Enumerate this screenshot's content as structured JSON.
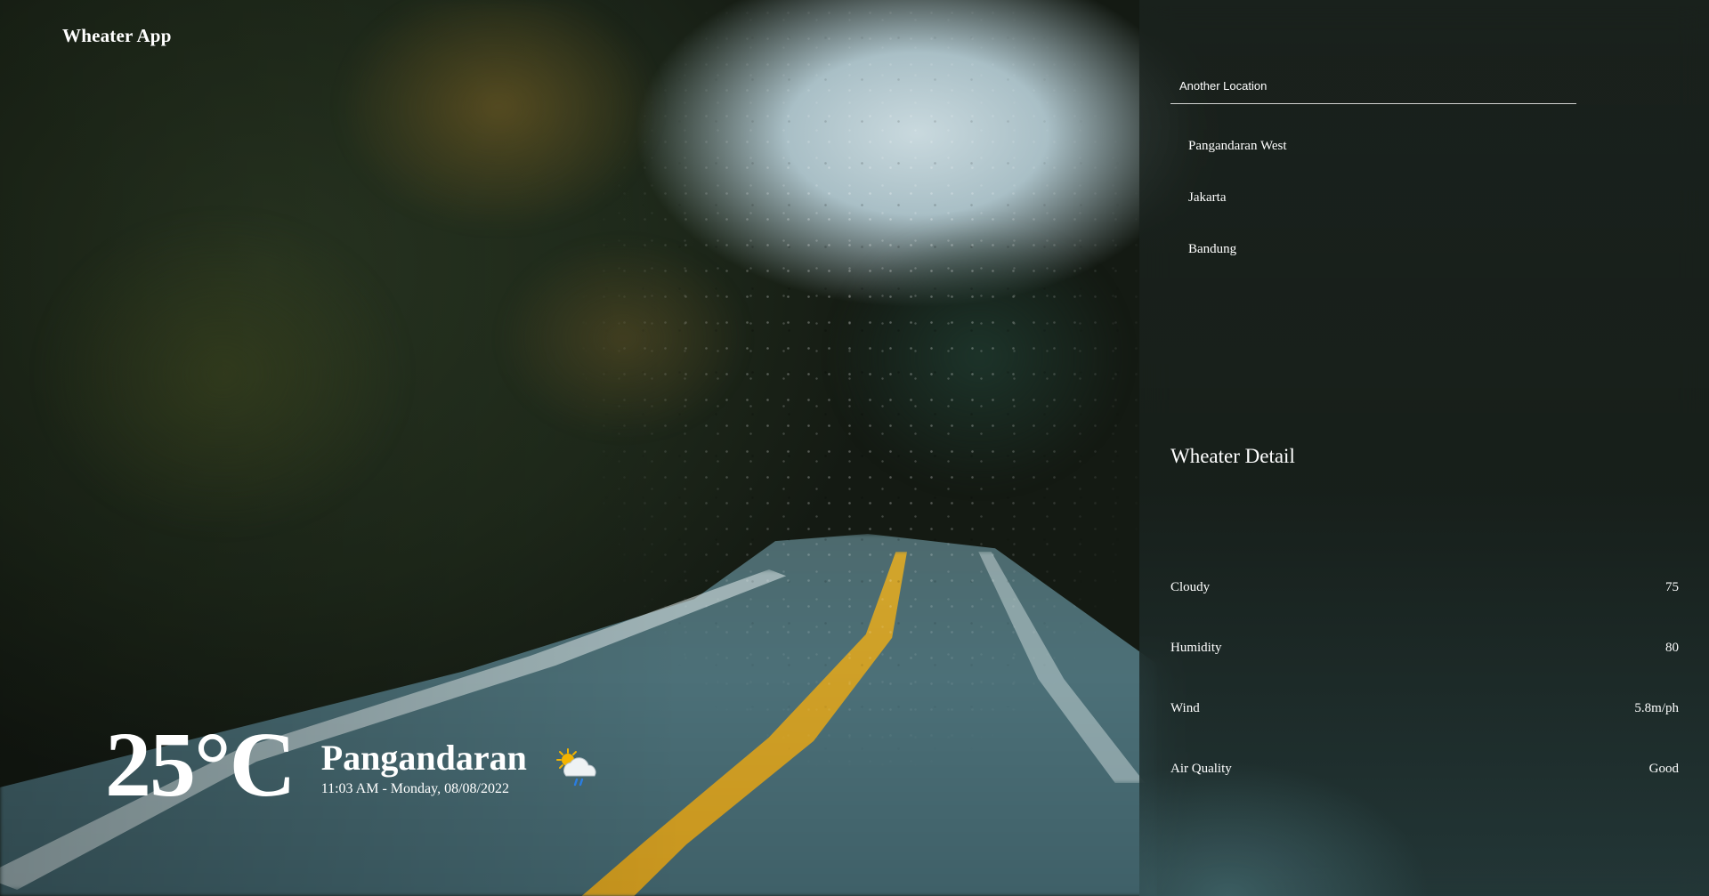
{
  "app": {
    "title": "Wheater App"
  },
  "current": {
    "temperature": "25°C",
    "city": "Pangandaran",
    "datetime": "11:03 AM - Monday, 08/08/2022",
    "icon": "sun-cloud-rain-icon"
  },
  "sidebar": {
    "search": {
      "placeholder": "Another Location",
      "value": ""
    },
    "locations": [
      {
        "label": "Pangandaran West"
      },
      {
        "label": "Jakarta"
      },
      {
        "label": "Bandung"
      }
    ],
    "detail_title": "Wheater Detail",
    "details": [
      {
        "label": "Cloudy",
        "value": "75"
      },
      {
        "label": "Humidity",
        "value": "80"
      },
      {
        "label": "Wind",
        "value": "5.8m/ph"
      },
      {
        "label": "Air Quality",
        "value": "Good"
      }
    ]
  },
  "colors": {
    "text": "#ffffff",
    "panel": "#1c2420",
    "road_line": "#d2a52c",
    "sun": "#f4b400",
    "rain": "#2a7de1"
  }
}
